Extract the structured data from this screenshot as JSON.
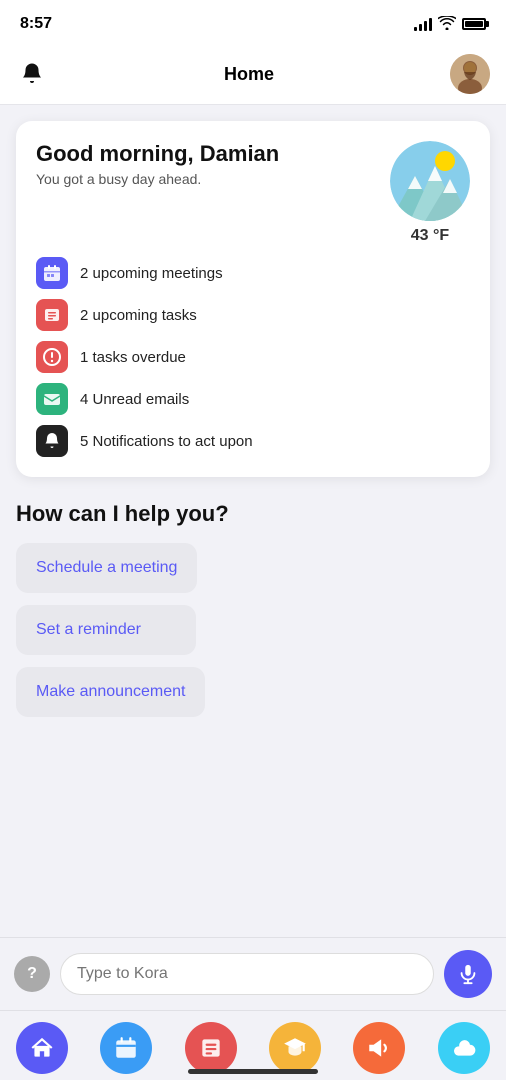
{
  "statusBar": {
    "time": "8:57"
  },
  "header": {
    "title": "Home",
    "bellLabel": "notifications bell",
    "avatarAlt": "user avatar"
  },
  "greetingCard": {
    "title": "Good morning, Damian",
    "subtitle": "You got a busy day ahead.",
    "stats": [
      {
        "id": "meetings",
        "label": "2 upcoming meetings",
        "color": "#5a5af5",
        "iconType": "calendar"
      },
      {
        "id": "tasks",
        "label": "2 upcoming tasks",
        "color": "#e55353",
        "iconType": "list"
      },
      {
        "id": "overdue",
        "label": "1 tasks overdue",
        "color": "#e55353",
        "iconType": "clock"
      },
      {
        "id": "emails",
        "label": "4 Unread emails",
        "color": "#2db37d",
        "iconType": "email"
      },
      {
        "id": "notifications",
        "label": "5 Notifications to act upon",
        "color": "#222",
        "iconType": "bell"
      }
    ],
    "weather": {
      "temp": "43 °F"
    }
  },
  "helpSection": {
    "title": "How can I help you?",
    "buttons": [
      {
        "id": "schedule",
        "label": "Schedule a meeting"
      },
      {
        "id": "reminder",
        "label": "Set a reminder"
      },
      {
        "id": "announce",
        "label": "Make announcement"
      }
    ]
  },
  "inputBar": {
    "placeholder": "Type to Kora",
    "helpBtnLabel": "?"
  },
  "bottomNav": {
    "items": [
      {
        "id": "home",
        "label": "Home",
        "iconType": "home"
      },
      {
        "id": "calendar",
        "label": "Calendar",
        "iconType": "calendar"
      },
      {
        "id": "tasks",
        "label": "Tasks",
        "iconType": "tasks"
      },
      {
        "id": "edu",
        "label": "Education",
        "iconType": "graduation"
      },
      {
        "id": "announce",
        "label": "Announce",
        "iconType": "megaphone"
      },
      {
        "id": "cloud",
        "label": "Cloud",
        "iconType": "cloud"
      }
    ]
  }
}
